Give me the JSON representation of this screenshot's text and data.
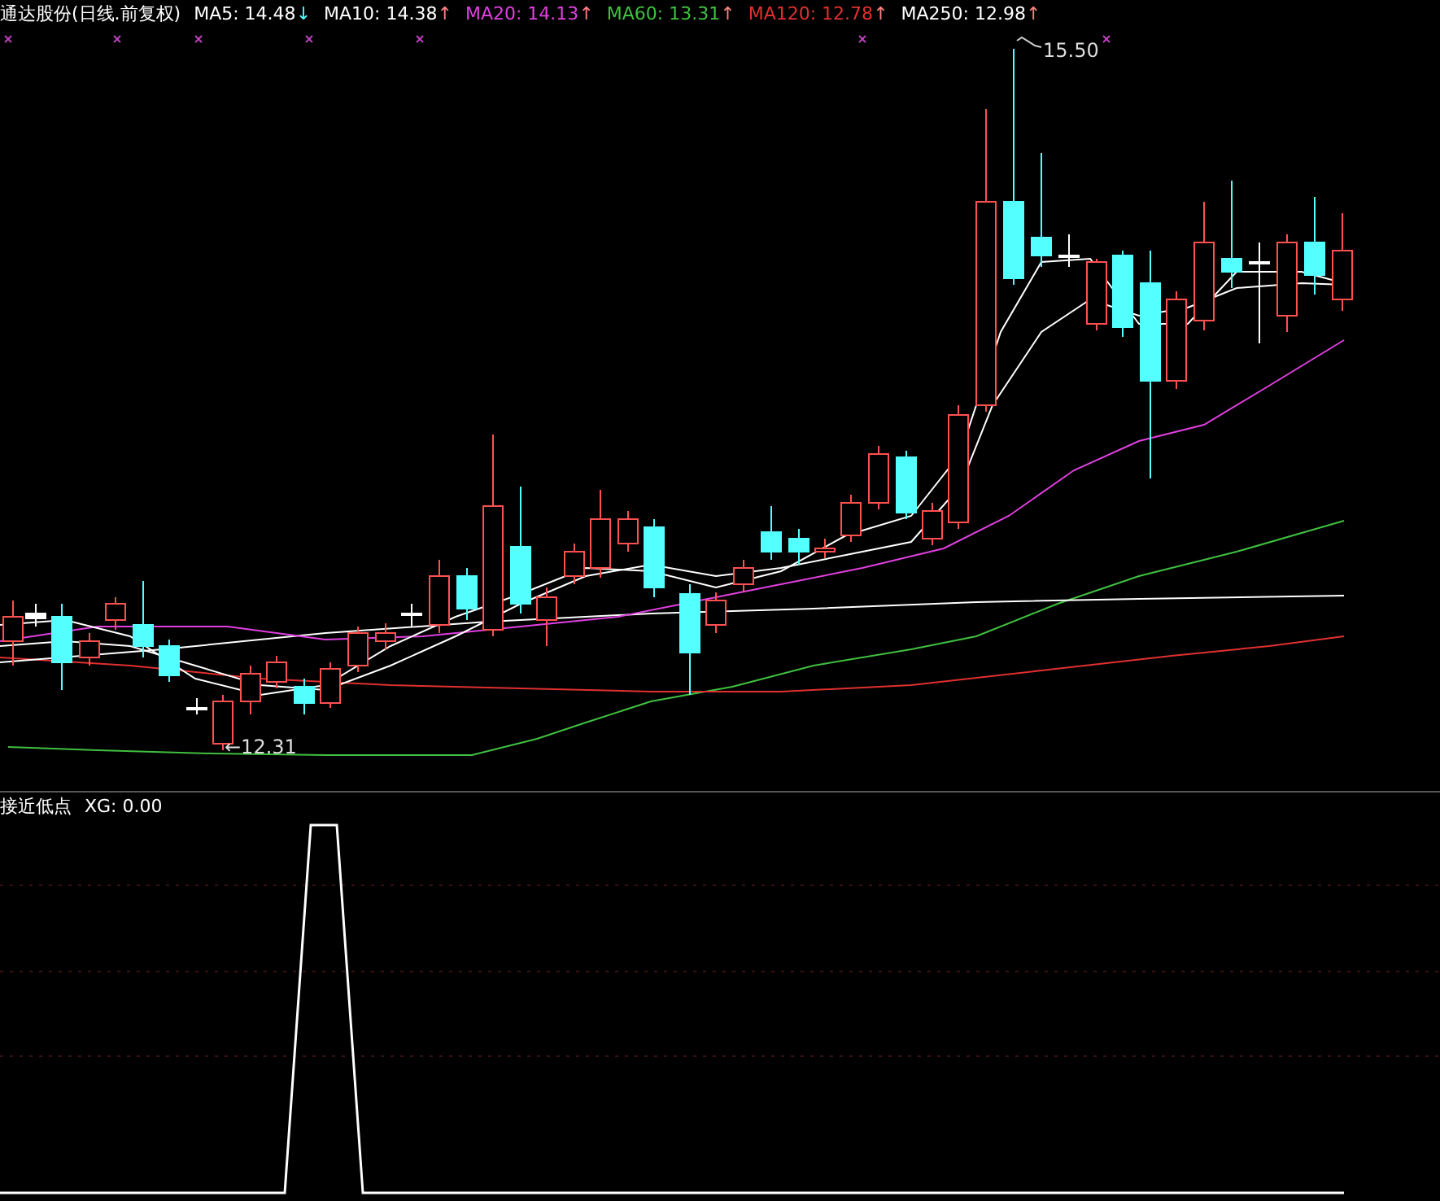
{
  "main_panel": {
    "title": "通达股份(日线.前复权)",
    "indicators": [
      {
        "label": "MA5: 14.48",
        "color": "#ffffff",
        "trend": {
          "arrow": "↓",
          "color": "#54ffff"
        }
      },
      {
        "label": "MA10: 14.38",
        "color": "#ffffff",
        "trend": {
          "arrow": "↑",
          "color": "#ff8080"
        }
      },
      {
        "label": "MA20: 14.13",
        "color": "#e040e0",
        "trend": {
          "arrow": "↑",
          "color": "#ff8080"
        }
      },
      {
        "label": "MA60: 13.31",
        "color": "#40c040",
        "trend": {
          "arrow": "↑",
          "color": "#ff8080"
        }
      },
      {
        "label": "MA120: 12.78",
        "color": "#e03030",
        "trend": {
          "arrow": "↑",
          "color": "#ff8080"
        }
      },
      {
        "label": "MA250: 12.98",
        "color": "#ffffff",
        "trend": {
          "arrow": "↑",
          "color": "#ff8080"
        }
      }
    ],
    "high_label": "15.50",
    "low_label": "←12.31"
  },
  "sub_panel": {
    "title": "接近低点",
    "indicator": "XG: 0.00"
  }
}
